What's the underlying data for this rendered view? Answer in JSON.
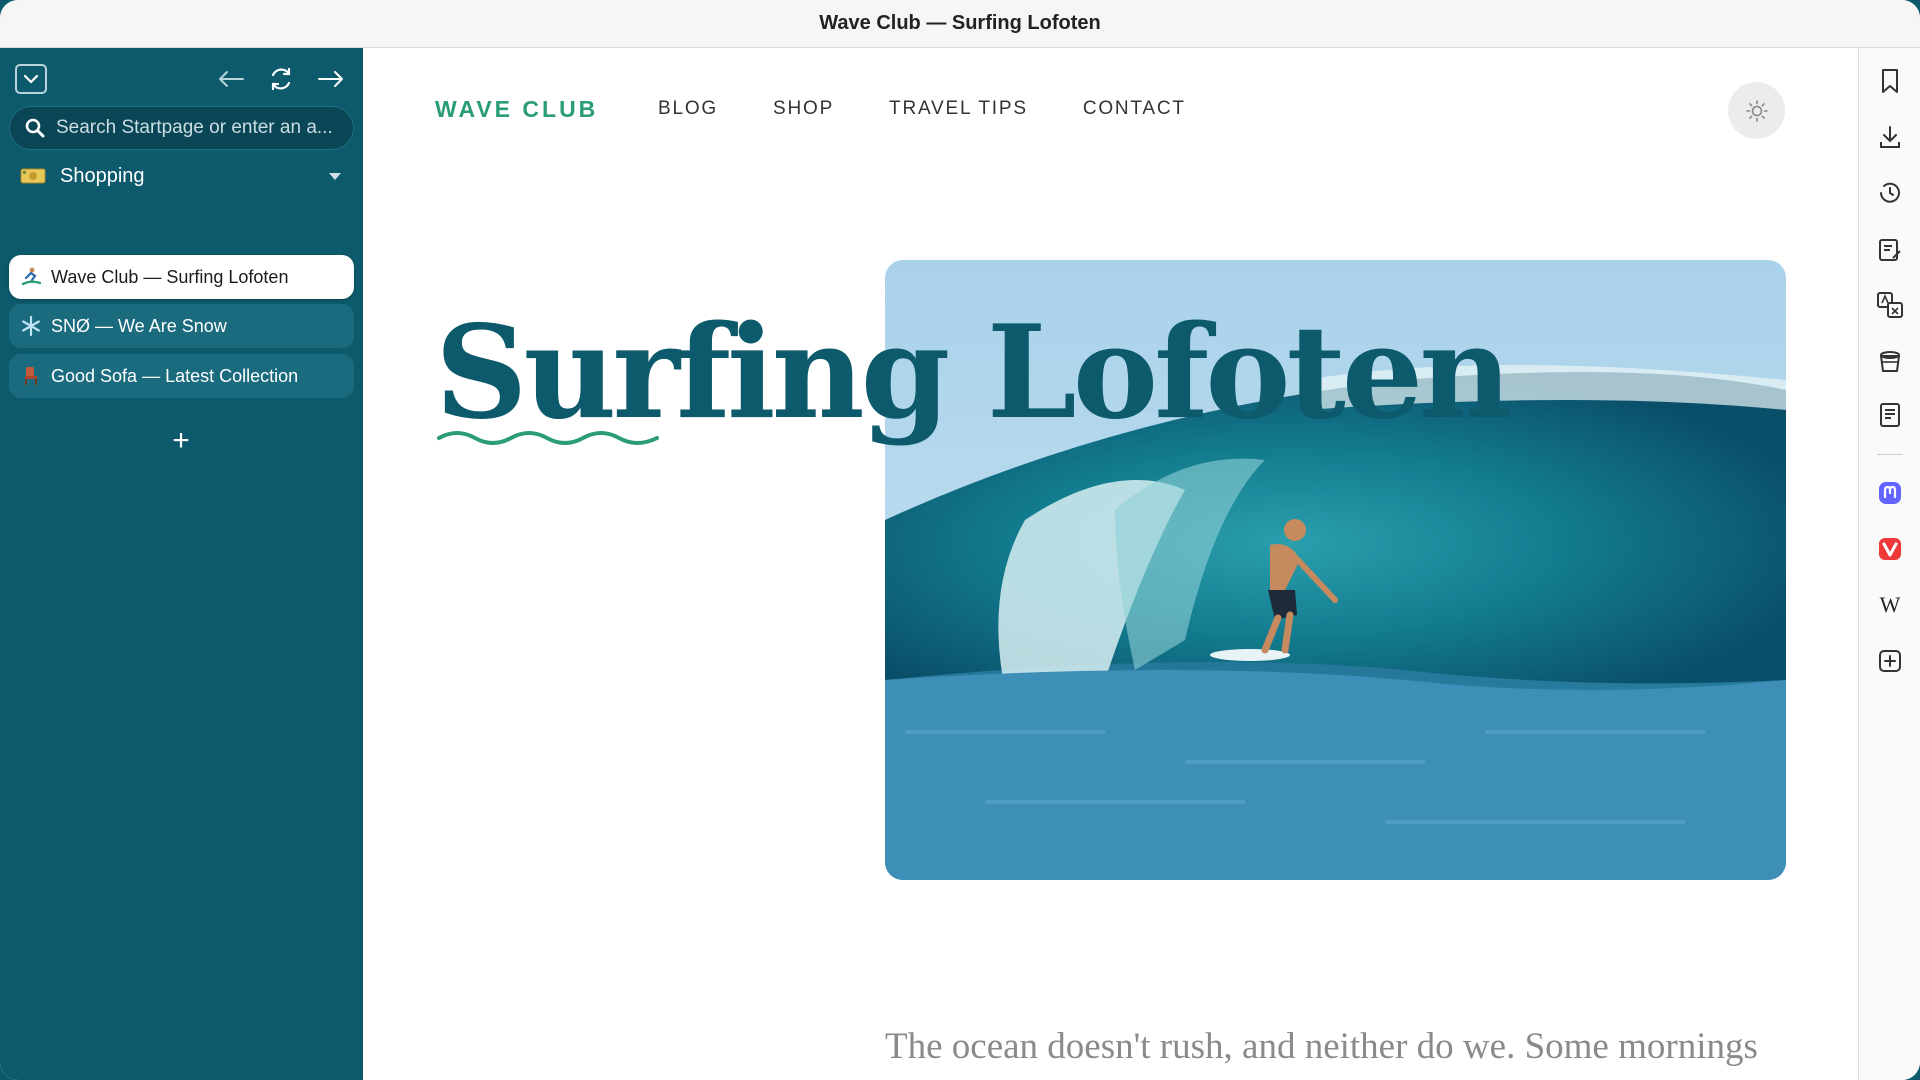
{
  "window": {
    "title": "Wave Club — Surfing Lofoten"
  },
  "sidebar": {
    "search": {
      "placeholder": "Search Startpage or enter an a..."
    },
    "workspace": {
      "emoji": "money-emoji",
      "label": "Shopping"
    },
    "tabs": [
      {
        "label": "Wave Club — Surfing Lofoten",
        "icon": "surfer-favicon",
        "active": true
      },
      {
        "label": "SNØ — We Are Snow",
        "icon": "snowflake-favicon",
        "active": false
      },
      {
        "label": "Good Sofa — Latest Collection",
        "icon": "chair-favicon",
        "active": false
      }
    ],
    "new_tab_label": "+"
  },
  "panel": {
    "icons": [
      "bookmarks-icon",
      "downloads-icon",
      "history-icon",
      "notes-icon",
      "translate-icon",
      "reading-list-icon",
      "window-panel-icon",
      "mastodon-icon",
      "vivaldi-icon",
      "wikipedia-icon",
      "add-panel-icon"
    ],
    "wikipedia_glyph": "W"
  },
  "page": {
    "logo": "WAVE CLUB",
    "menu": [
      "BLOG",
      "SHOP",
      "TRAVEL TIPS",
      "CONTACT"
    ],
    "headline": "Surfing Lofoten",
    "lead": "The ocean doesn't rush, and neither do we. Some mornings are just about being there."
  },
  "colors": {
    "accent": "#2a9d74",
    "brand": "#0d5a6c",
    "sidebar_bg": "#0d5a6c"
  }
}
